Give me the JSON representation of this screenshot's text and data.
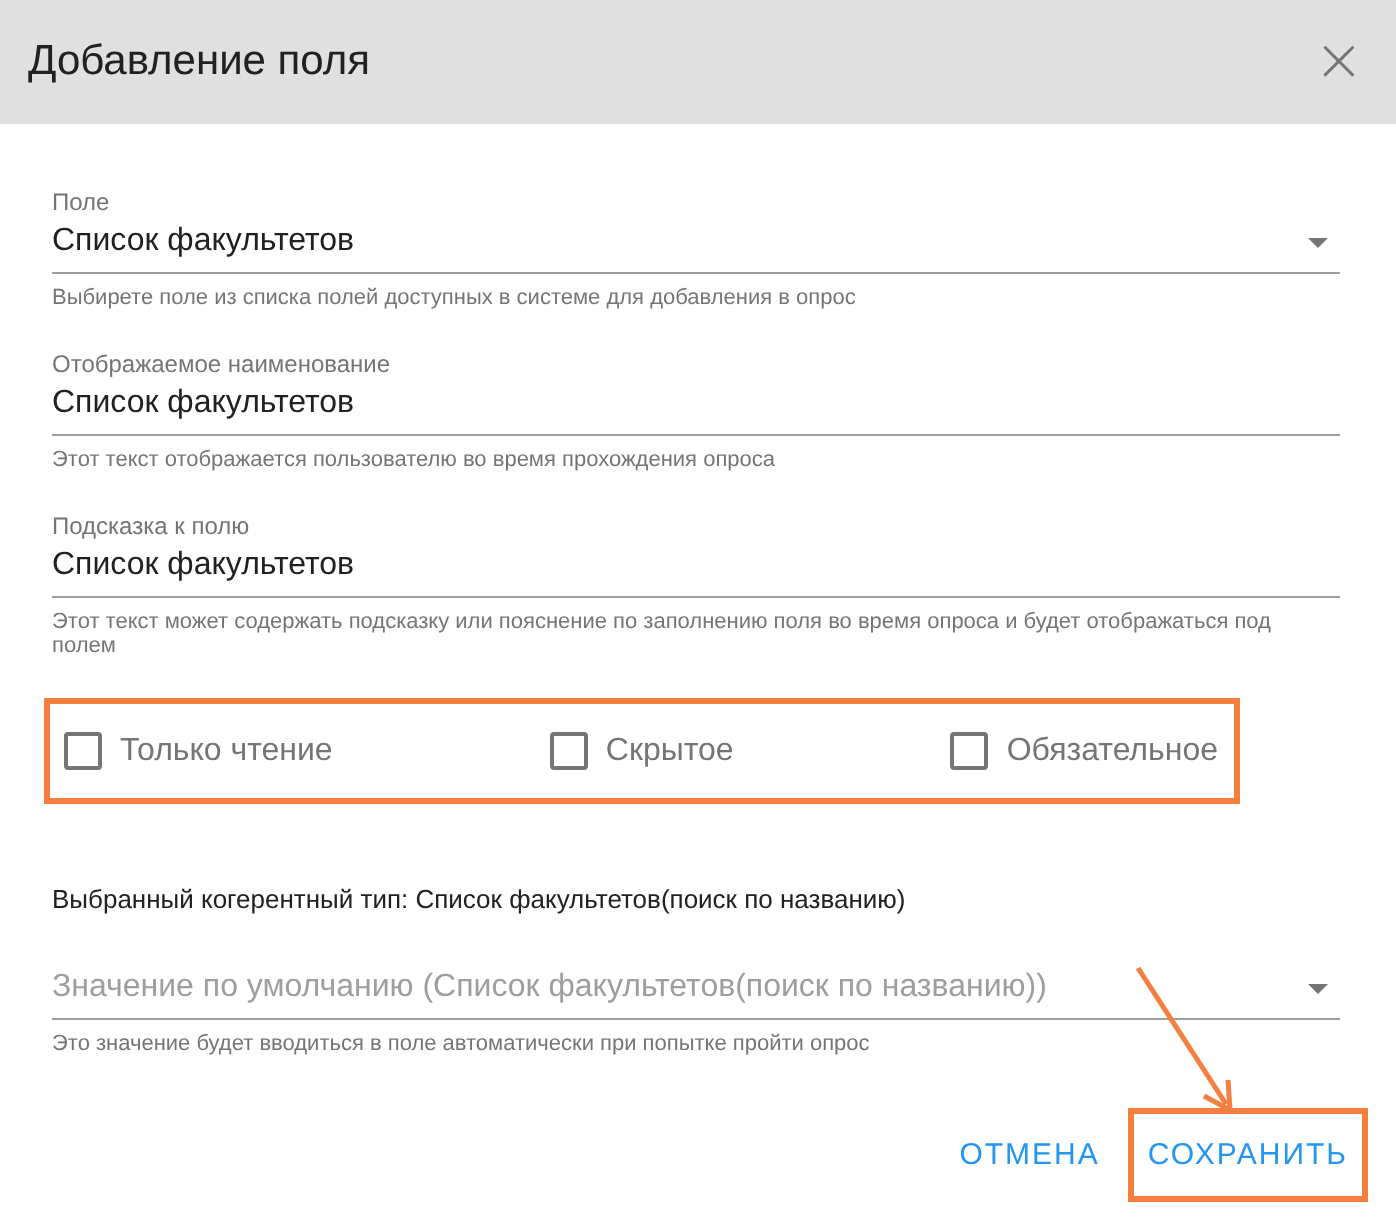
{
  "dialog": {
    "title": "Добавление поля",
    "close_icon": "×"
  },
  "fields": [
    {
      "kind": "select",
      "label": "Поле",
      "value": "Список факультетов",
      "helper": "Выбирете поле из списка полей доступных в системе для добавления в опрос"
    },
    {
      "kind": "text",
      "label": "Отображаемое наименование",
      "value": "Список факультетов",
      "helper": "Этот текст отображается пользователю во время прохождения опроса"
    },
    {
      "kind": "text",
      "label": "Подсказка к полю",
      "value": "Список факультетов",
      "helper": "Этот текст может содержать подсказку или пояснение по заполнению поля во время опроса и будет отображаться под полем"
    }
  ],
  "checkboxes": [
    {
      "label": "Только чтение",
      "checked": false
    },
    {
      "label": "Скрытое",
      "checked": false
    },
    {
      "label": "Обязательное",
      "checked": false
    }
  ],
  "coherent_type": "Выбранный когерентный тип: Список факультетов(поиск по названию)",
  "default_field": {
    "placeholder": "Значение по умолчанию (Список факультетов(поиск по названию))",
    "helper": "Это значение будет вводиться в поле автоматически при попытке пройти опрос"
  },
  "buttons": [
    {
      "label": "ОТМЕНА",
      "highlighted": false
    },
    {
      "label": "СОХРАНИТЬ",
      "highlighted": true
    }
  ]
}
